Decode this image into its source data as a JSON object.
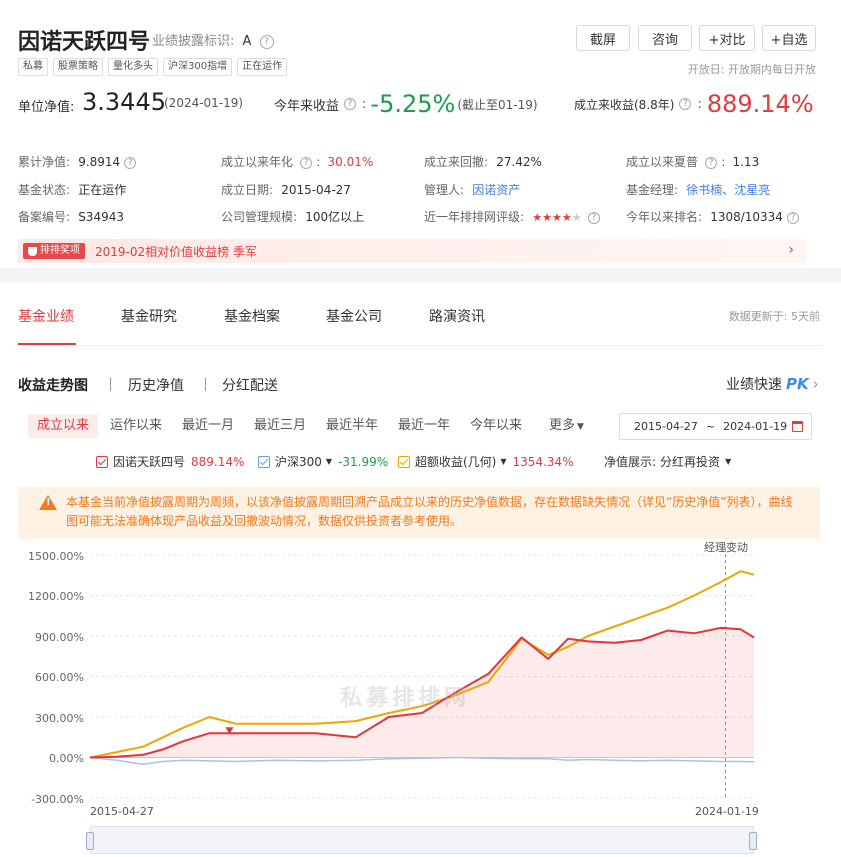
{
  "header": {
    "fund_name": "因诺天跃四号",
    "disclosure_label": "业绩披露标识:",
    "disclosure_value": "A",
    "tags": [
      "私募",
      "股票策略",
      "量化多头",
      "沪深300指增",
      "正在运作"
    ],
    "buttons": [
      "截屏",
      "咨询",
      "+对比",
      "+自选"
    ],
    "open_day": "开放日: 开放期内每日开放",
    "nav_label": "单位净值:",
    "nav_value": "3.3445",
    "nav_date": "(2024-01-19)",
    "ytd_label": "今年来收益",
    "ytd_value": "-5.25%",
    "ytd_note": "(截止至01-19)",
    "since_label": "成立来收益(8.8年)",
    "since_value": "889.14%"
  },
  "stats": {
    "row1": [
      {
        "label": "累计净值:",
        "value": "9.8914",
        "q": true
      },
      {
        "label": "成立以来年化",
        "value": "30.01%",
        "q": true,
        "sep": ":",
        "color": "red"
      },
      {
        "label": "成立来回撤:",
        "value": "27.42%"
      },
      {
        "label": "成立以来夏普",
        "value": "1.13",
        "q": true,
        "sep": ":"
      }
    ],
    "row2": [
      {
        "label": "基金状态:",
        "value": "正在运作"
      },
      {
        "label": "成立日期:",
        "value": "2015-04-27"
      },
      {
        "label": "管理人:",
        "value": "因诺资产",
        "color": "blue"
      },
      {
        "label": "基金经理:",
        "value": "徐书楠、沈星亮",
        "color": "blue"
      }
    ],
    "row3": [
      {
        "label": "备案编号:",
        "value": "S34943"
      },
      {
        "label": "公司管理规模:",
        "value": "100亿以上"
      },
      {
        "label": "近一年排排网评级:",
        "value": "",
        "stars": 4
      },
      {
        "label": "今年以来排名:",
        "value": "1308/10334",
        "q": true
      }
    ]
  },
  "award": {
    "badge": "排排奖项",
    "text": "2019-02相对价值收益榜 季军"
  },
  "tabs": {
    "main": [
      "基金业绩",
      "基金研究",
      "基金档案",
      "基金公司",
      "路演资讯"
    ],
    "update_note": "数据更新于: 5天前",
    "sub": [
      "收益走势图",
      "历史净值",
      "分红配送"
    ],
    "pk_label": "业绩快速",
    "pk_badge": "PK",
    "periods": [
      "成立以来",
      "运作以来",
      "最近一月",
      "最近三月",
      "最近半年",
      "最近一年",
      "今年以来"
    ],
    "more_label": "更多",
    "date_start": "2015-04-27",
    "date_sep": "~",
    "date_end": "2024-01-19"
  },
  "legend": {
    "items": [
      {
        "name": "因诺天跃四号",
        "value": "889.14%",
        "color": "#e8333a",
        "value_color": "red",
        "dropdown": false
      },
      {
        "name": "沪深300",
        "value": "-31.99%",
        "color": "#6a9be0",
        "value_color": "green",
        "dropdown": true
      },
      {
        "name": "超额收益(几何)",
        "value": "1354.34%",
        "color": "#f0a500",
        "value_color": "red",
        "dropdown": true
      }
    ],
    "nav_display_label": "净值展示:",
    "nav_display_value": "分红再投资"
  },
  "notice": {
    "text": "本基金当前净值披露周期为周频，以该净值披露周期回溯产品成立以来的历史净值数据，存在数据缺失情况（详见“历史净值”列表），曲线图可能无法准确体现产品收益及回撤波动情况，数据仅供投资者参考使用。"
  },
  "chart_data": {
    "type": "line",
    "y_ticks": [
      "1500.00%",
      "1200.00%",
      "900.00%",
      "600.00%",
      "300.00%",
      "0.00%",
      "-300.00%"
    ],
    "ylim": [
      -300,
      1500
    ],
    "x_labels": [
      "2015-04-27",
      "2024-01-19"
    ],
    "marker_label": "经理变动",
    "watermark": "私募排排网",
    "x": [
      0.0,
      0.04,
      0.08,
      0.11,
      0.14,
      0.18,
      0.22,
      0.28,
      0.34,
      0.4,
      0.45,
      0.5,
      0.55,
      0.6,
      0.65,
      0.69,
      0.72,
      0.75,
      0.79,
      0.83,
      0.87,
      0.91,
      0.95,
      0.98,
      1.0
    ],
    "series": [
      {
        "name": "因诺天跃四号",
        "color": "#e8333a",
        "values": [
          0,
          5,
          20,
          60,
          120,
          180,
          180,
          180,
          180,
          150,
          300,
          330,
          480,
          620,
          890,
          730,
          880,
          860,
          850,
          870,
          940,
          920,
          960,
          950,
          889
        ]
      },
      {
        "name": "沪深300",
        "color": "#a9c2e8",
        "values": [
          0,
          -20,
          -50,
          -30,
          -20,
          -25,
          -30,
          -20,
          -25,
          -20,
          -10,
          -5,
          0,
          -5,
          -10,
          -10,
          -20,
          -15,
          -20,
          -25,
          -20,
          -25,
          -30,
          -30,
          -32
        ]
      },
      {
        "name": "超额收益(几何)",
        "color": "#f0a500",
        "values": [
          0,
          40,
          80,
          150,
          220,
          300,
          250,
          250,
          250,
          270,
          330,
          380,
          460,
          560,
          880,
          760,
          820,
          900,
          970,
          1040,
          1110,
          1200,
          1300,
          1380,
          1354
        ]
      }
    ]
  }
}
